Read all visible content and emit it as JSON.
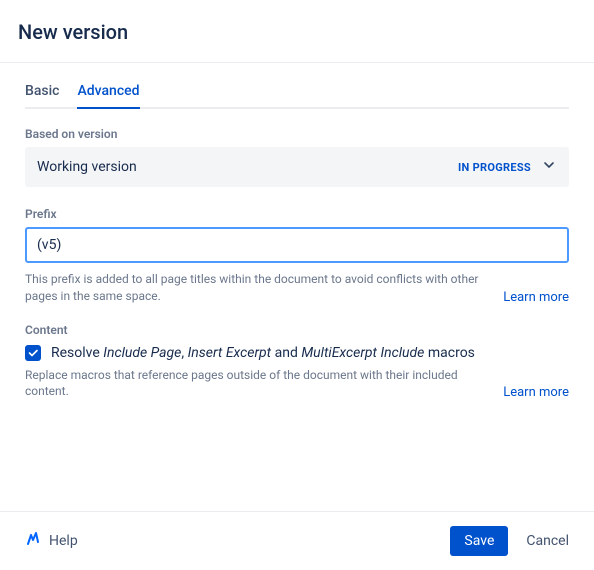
{
  "title": "New version",
  "tabs": {
    "basic": "Basic",
    "advanced": "Advanced"
  },
  "basedOn": {
    "label": "Based on version",
    "value": "Working version",
    "status": "IN PROGRESS"
  },
  "prefix": {
    "label": "Prefix",
    "value": "(v5)",
    "help": "This prefix is added to all page titles within the document to avoid conflicts with other pages in the same space.",
    "learnMore": "Learn more"
  },
  "contentSection": {
    "label": "Content",
    "resolve": {
      "pre": "Resolve ",
      "m1": "Include Page",
      "sep1": ", ",
      "m2": "Insert Excerpt",
      "sep2": " and ",
      "m3": "MultiExcerpt Include",
      "post": " macros"
    },
    "help": "Replace macros that reference pages outside of the document with their included content.",
    "learnMore": "Learn more"
  },
  "footer": {
    "help": "Help",
    "save": "Save",
    "cancel": "Cancel"
  }
}
